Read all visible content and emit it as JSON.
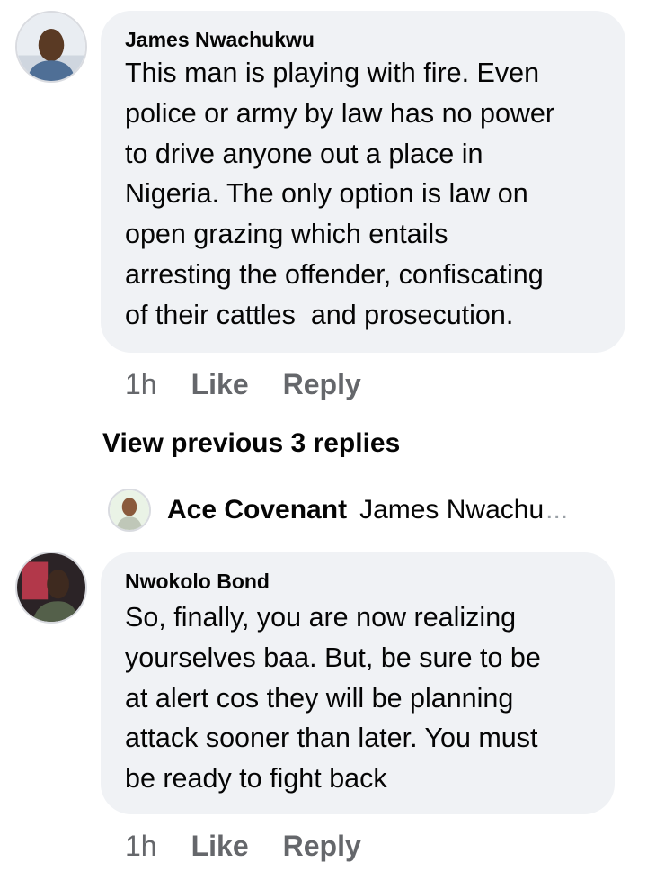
{
  "comments": [
    {
      "author": "James Nwachukwu",
      "text": "This man is playing with fire. Even\npolice or army by law has no power\nto drive anyone out a place in\nNigeria. The only option is law on\nopen grazing which entails\narresting the offender, confiscating\nof their cattles  and prosecution.",
      "time": "1h",
      "like_label": "Like",
      "reply_label": "Reply",
      "avatar_icon": "profile-photo"
    },
    {
      "author": "Nwokolo Bond",
      "text": "So, finally, you are now realizing\nyourselves baa. But, be sure to be\nat alert cos they will be planning\nattack sooner than later. You must\nbe ready to fight back",
      "time": "1h",
      "like_label": "Like",
      "reply_label": "Reply",
      "avatar_icon": "profile-photo"
    }
  ],
  "replies_thread": {
    "view_previous_label": "View previous 3 replies",
    "latest_reply": {
      "author": "Ace Covenant",
      "snippet": "James Nwachu",
      "ellipsis": "...",
      "avatar_icon": "profile-photo"
    }
  },
  "colors": {
    "bubble": "#f0f2f5",
    "muted_text": "#65676b",
    "primary_text": "#050505"
  }
}
